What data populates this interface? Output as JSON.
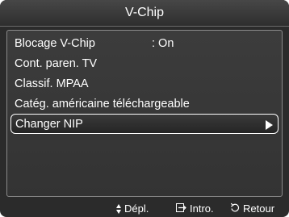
{
  "title": "V-Chip",
  "menu": {
    "items": [
      {
        "label": "Blocage V-Chip",
        "value": ": On"
      },
      {
        "label": "Cont. paren. TV",
        "value": ""
      },
      {
        "label": "Classif. MPAA",
        "value": ""
      },
      {
        "label": "Catég. américaine téléchargeable",
        "value": ""
      },
      {
        "label": "Changer NIP",
        "value": "",
        "selected": true
      }
    ]
  },
  "footer": {
    "move": {
      "icon": "updown-arrow-icon",
      "label": "Dépl."
    },
    "enter": {
      "icon": "enter-icon",
      "label": "Intro."
    },
    "return": {
      "icon": "return-icon",
      "label": "Retour"
    }
  },
  "colors": {
    "background": "#2b2b2b",
    "text": "#ffffff",
    "panel_border": "#8a8a8a",
    "selection_border": "#ffffff"
  }
}
